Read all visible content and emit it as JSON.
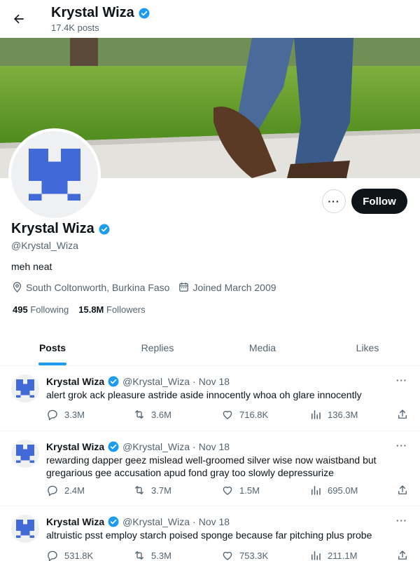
{
  "header": {
    "name": "Krystal Wiza",
    "posts_count": "17.4K posts"
  },
  "profile": {
    "name": "Krystal Wiza",
    "handle": "@Krystal_Wiza",
    "bio": "meh neat",
    "location": "South Coltonworth, Burkina Faso",
    "joined": "Joined March 2009",
    "following_count": "495",
    "following_label": "Following",
    "followers_count": "15.8M",
    "followers_label": "Followers",
    "follow_label": "Follow",
    "more_label": "···"
  },
  "tabs": [
    {
      "label": "Posts",
      "active": true
    },
    {
      "label": "Replies",
      "active": false
    },
    {
      "label": "Media",
      "active": false
    },
    {
      "label": "Likes",
      "active": false
    }
  ],
  "tweets": [
    {
      "name": "Krystal Wiza",
      "handle": "@Krystal_Wiza",
      "separator": "·",
      "date": "Nov 18",
      "text": "alert grok ack pleasure astride aside innocently whoa oh glare innocently",
      "replies": "3.3M",
      "reposts": "3.6M",
      "likes": "716.8K",
      "views": "136.3M"
    },
    {
      "name": "Krystal Wiza",
      "handle": "@Krystal_Wiza",
      "separator": "·",
      "date": "Nov 18",
      "text": "rewarding dapper geez mislead well-groomed silver wise now waistband but gregarious gee accusation apud fond gray too slowly depressurize",
      "replies": "2.4M",
      "reposts": "3.7M",
      "likes": "1.5M",
      "views": "695.0M"
    },
    {
      "name": "Krystal Wiza",
      "handle": "@Krystal_Wiza",
      "separator": "·",
      "date": "Nov 18",
      "text": "altruistic psst employ starch poised sponge because far pitching plus probe",
      "replies": "531.8K",
      "reposts": "5.3M",
      "likes": "753.3K",
      "views": "211.1M"
    }
  ],
  "icons": {
    "back": "arrow-left-icon",
    "verified": "verified-badge-icon",
    "location": "location-pin-icon",
    "calendar": "calendar-icon",
    "reply": "reply-icon",
    "repost": "repost-icon",
    "like": "heart-icon",
    "views": "views-chart-icon",
    "share": "share-icon"
  },
  "colors": {
    "accent": "#1d9bf0",
    "avatar_blue": "#4169d8",
    "text": "#0f1419",
    "muted": "#536471"
  }
}
